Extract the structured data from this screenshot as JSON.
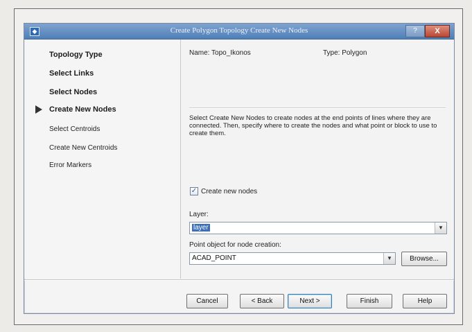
{
  "window": {
    "title": "Create Polygon Topology   Create New Nodes",
    "help_btn": "?",
    "close_btn": "X"
  },
  "steps": [
    {
      "label": "Topology Type"
    },
    {
      "label": "Select Links"
    },
    {
      "label": "Select Nodes"
    },
    {
      "label": "Create New Nodes"
    },
    {
      "label": "Select Centroids"
    },
    {
      "label": "Create New Centroids"
    },
    {
      "label": "Error Markers"
    }
  ],
  "info": {
    "name": "Name: Topo_Ikonos",
    "type": "Type: Polygon"
  },
  "description": "Select Create New Nodes to create nodes at the end points of lines where they are connected. Then, specify where to create the nodes and what point or block to use to create them.",
  "create_nodes": {
    "label": "Create new nodes",
    "checked": true
  },
  "layer": {
    "label": "Layer:",
    "value": "layer"
  },
  "point_object": {
    "label": "Point object for node creation:",
    "value": "ACAD_POINT",
    "browse": "Browse..."
  },
  "buttons": {
    "cancel": "Cancel",
    "back": "< Back",
    "next": "Next >",
    "finish": "Finish",
    "help": "Help"
  },
  "icons": {
    "current_step": "right-triangle-arrow",
    "dropdown": "chevron-down"
  }
}
